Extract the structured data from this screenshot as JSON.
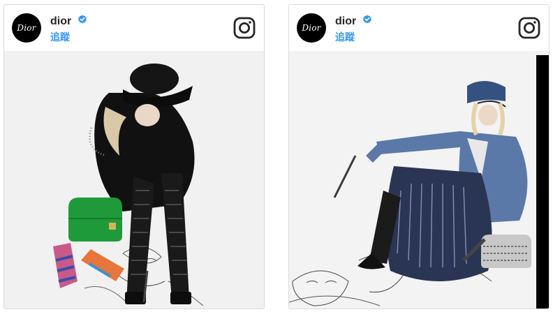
{
  "posts": [
    {
      "username": "dior",
      "avatar_text": "Dior",
      "follow_label": "追蹤",
      "verified_icon": "verified-badge-icon",
      "logo_icon": "instagram-icon",
      "photo_subject": "fashion-photo"
    },
    {
      "username": "dior",
      "avatar_text": "Dior",
      "follow_label": "追蹤",
      "verified_icon": "verified-badge-icon",
      "logo_icon": "instagram-icon",
      "photo_subject": "fashion-photo"
    }
  ],
  "colors": {
    "username": "#262626",
    "follow": "#3897f0",
    "verified": "#3897f0",
    "border": "#dbdbdb"
  }
}
